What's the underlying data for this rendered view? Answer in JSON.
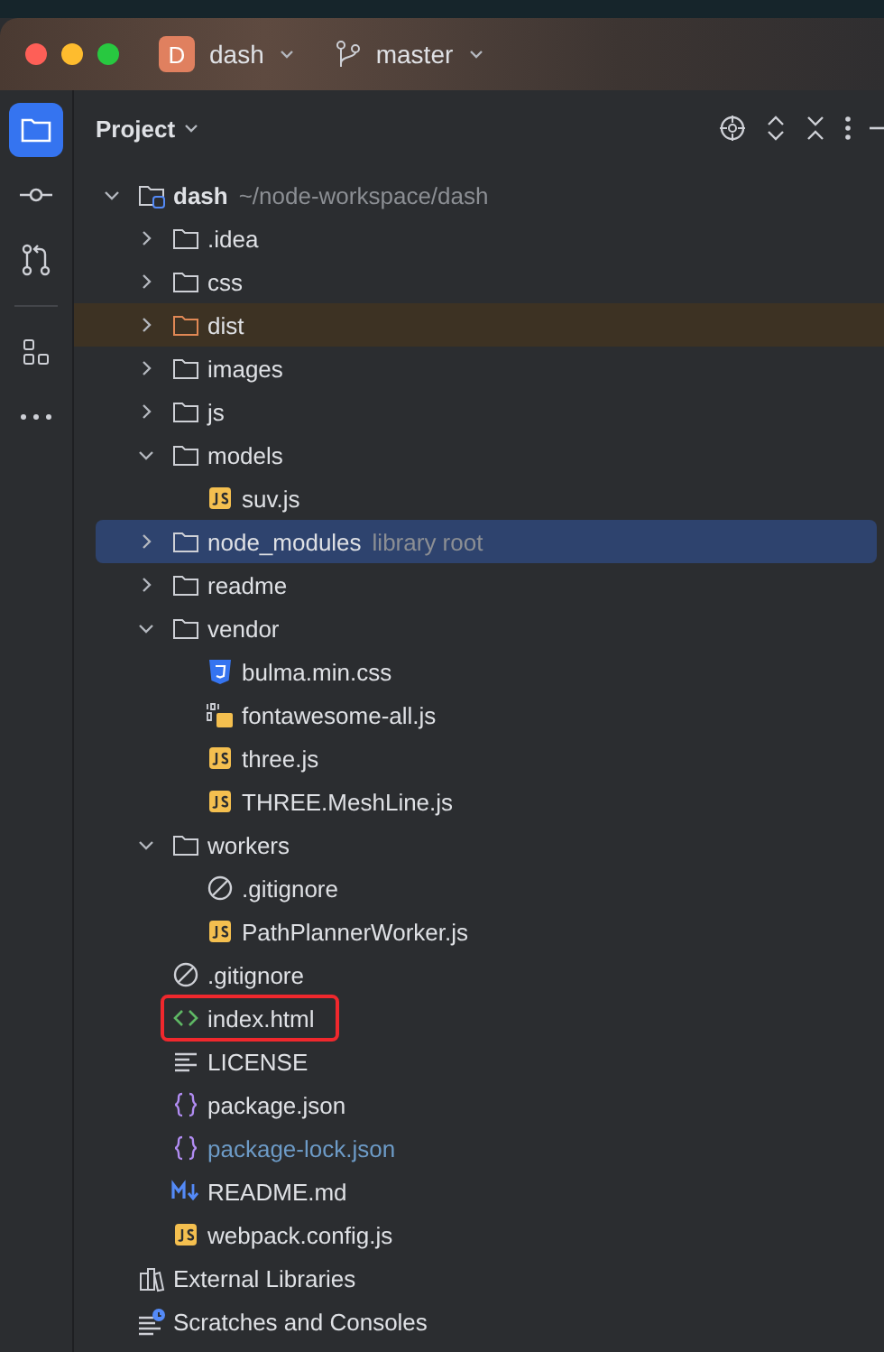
{
  "title_bar": {
    "project_badge": "D",
    "project": "dash",
    "branch": "master"
  },
  "tool_stripe": [
    {
      "kind": "project",
      "selected": true
    },
    {
      "kind": "commit",
      "selected": false
    },
    {
      "kind": "pull-requests",
      "selected": false
    },
    {
      "kind": "divider"
    },
    {
      "kind": "structure",
      "selected": false
    },
    {
      "kind": "more",
      "selected": false
    }
  ],
  "panel": {
    "title": "Project"
  },
  "tree": [
    {
      "name": "dash",
      "kind": "project",
      "path": "~/node-workspace/dash",
      "expanded": true,
      "selected": false,
      "children": [
        {
          "name": ".idea",
          "kind": "folder",
          "expanded": false,
          "selected": false
        },
        {
          "name": "css",
          "kind": "folder",
          "expanded": false,
          "selected": false
        },
        {
          "name": "dist",
          "kind": "folder",
          "excluded": true,
          "expanded": false,
          "selected": false
        },
        {
          "name": "images",
          "kind": "folder",
          "expanded": false,
          "selected": false
        },
        {
          "name": "js",
          "kind": "folder",
          "expanded": false,
          "selected": false
        },
        {
          "name": "models",
          "kind": "folder",
          "expanded": true,
          "selected": false,
          "children": [
            {
              "name": "suv.js",
              "kind": "js",
              "selected": false
            }
          ]
        },
        {
          "name": "node_modules",
          "kind": "folder",
          "suffix": "library root",
          "expanded": false,
          "selected": true
        },
        {
          "name": "readme",
          "kind": "folder",
          "expanded": false,
          "selected": false
        },
        {
          "name": "vendor",
          "kind": "folder",
          "expanded": true,
          "selected": false,
          "children": [
            {
              "name": "bulma.min.css",
              "kind": "css",
              "selected": false
            },
            {
              "name": "fontawesome-all.js",
              "kind": "minified-js",
              "selected": false
            },
            {
              "name": "three.js",
              "kind": "js",
              "selected": false
            },
            {
              "name": "THREE.MeshLine.js",
              "kind": "js",
              "selected": false
            }
          ]
        },
        {
          "name": "workers",
          "kind": "folder",
          "expanded": true,
          "selected": false,
          "children": [
            {
              "name": ".gitignore",
              "kind": "ignore",
              "selected": false
            },
            {
              "name": "PathPlannerWorker.js",
              "kind": "js",
              "selected": false
            }
          ]
        },
        {
          "name": ".gitignore",
          "kind": "ignore",
          "selected": false
        },
        {
          "name": "index.html",
          "kind": "html",
          "annotated": true,
          "selected": false
        },
        {
          "name": "LICENSE",
          "kind": "text",
          "selected": false
        },
        {
          "name": "package.json",
          "kind": "json",
          "selected": false
        },
        {
          "name": "package-lock.json",
          "kind": "json",
          "vcs_ignored": true,
          "selected": false
        },
        {
          "name": "README.md",
          "kind": "markdown",
          "selected": false
        },
        {
          "name": "webpack.config.js",
          "kind": "js",
          "selected": false
        }
      ]
    },
    {
      "name": "External Libraries",
      "kind": "libraries",
      "selected": false
    },
    {
      "name": "Scratches and Consoles",
      "kind": "scratches",
      "selected": false
    }
  ]
}
